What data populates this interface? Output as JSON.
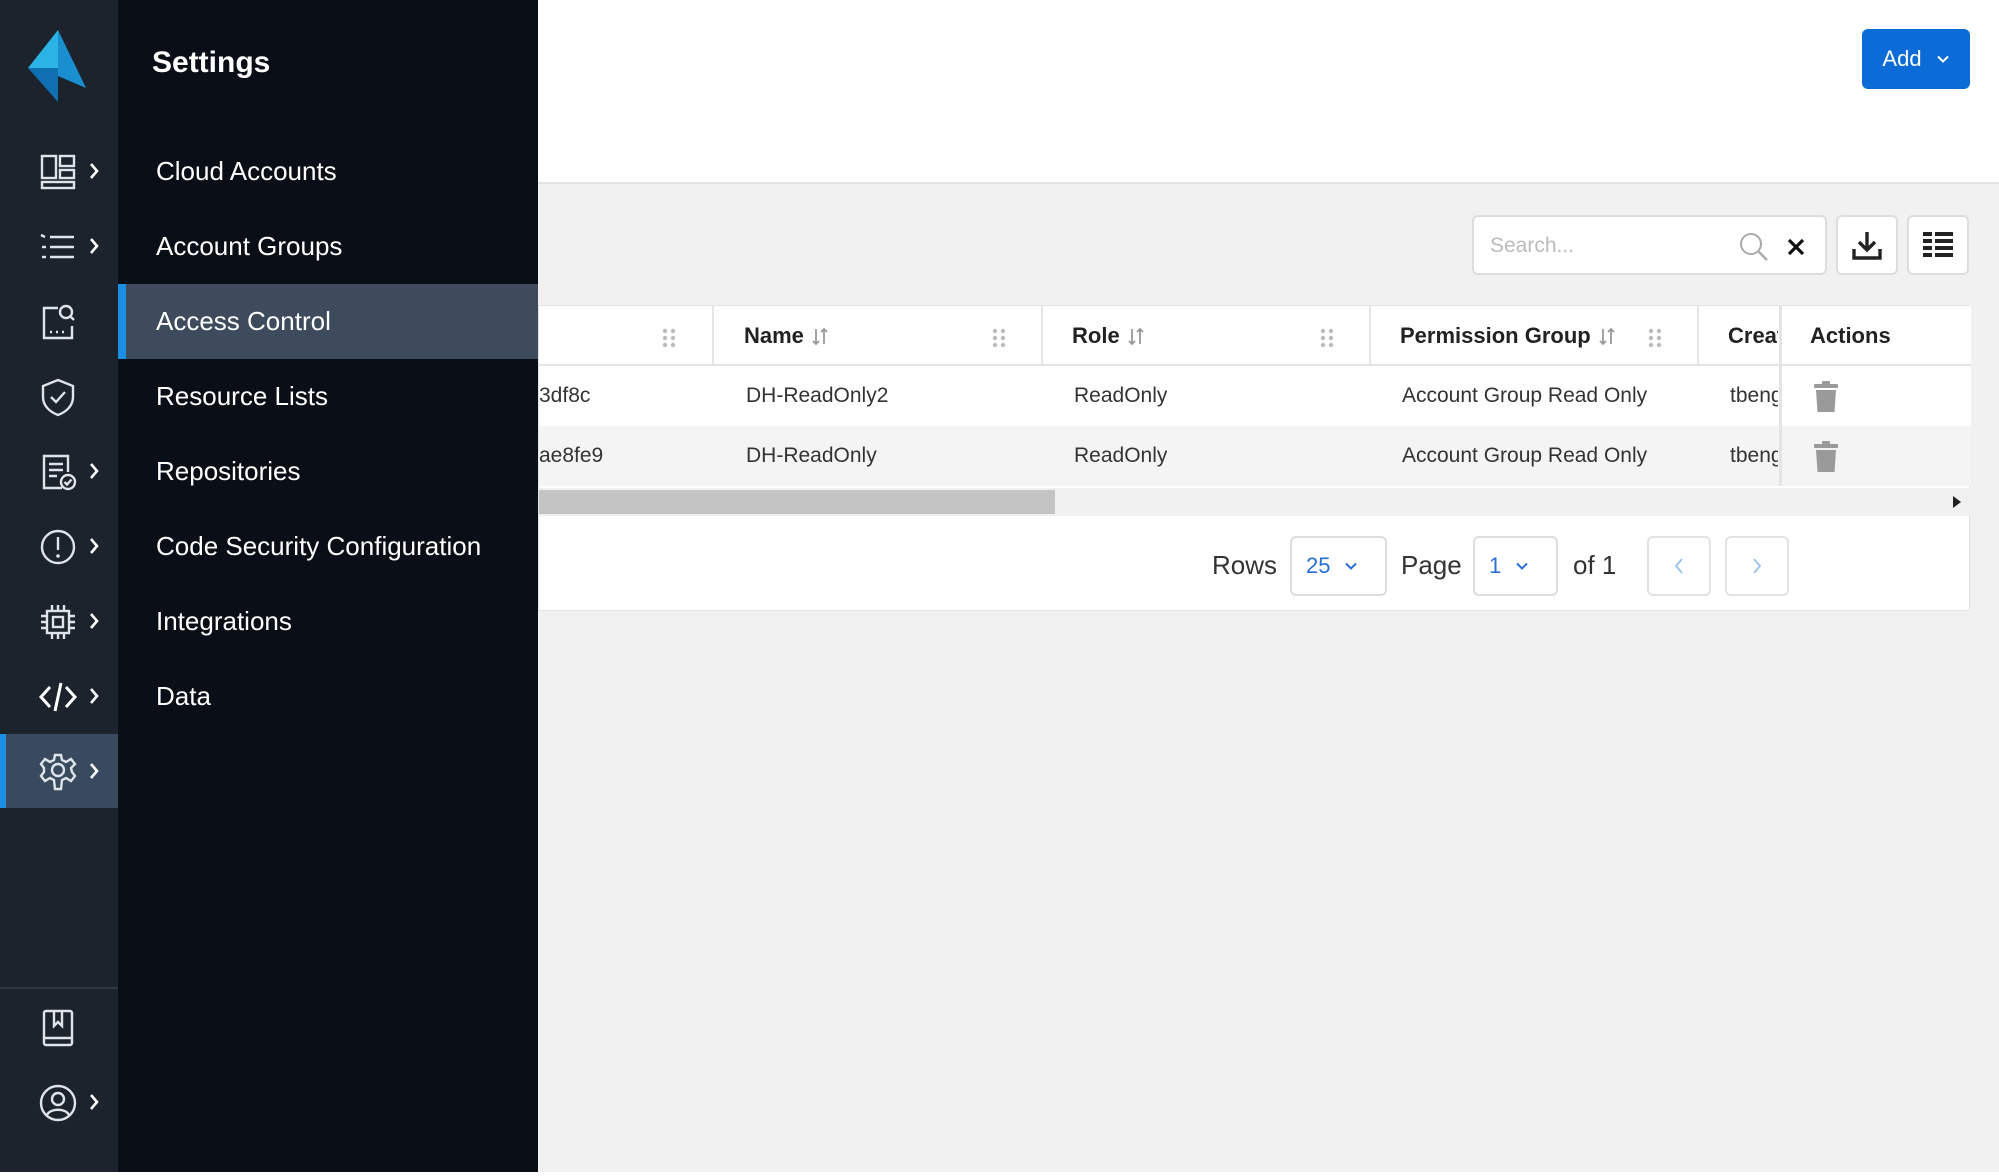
{
  "header": {
    "add_label": "Add"
  },
  "toolbar": {
    "search_placeholder": "Search..."
  },
  "table": {
    "columns": {
      "name": "Name",
      "role": "Role",
      "permission_group": "Permission Group",
      "created": "Creat",
      "actions": "Actions"
    },
    "rows": [
      {
        "id": "3df8c",
        "name": "DH-ReadOnly2",
        "role": "ReadOnly",
        "permission_group": "Account Group Read Only",
        "created_by": "tbeng"
      },
      {
        "id": "ae8fe9",
        "name": "DH-ReadOnly",
        "role": "ReadOnly",
        "permission_group": "Account Group Read Only",
        "created_by": "tbeng"
      }
    ]
  },
  "pagination": {
    "rows_label": "Rows",
    "rows_value": "25",
    "page_label": "Page",
    "page_value": "1",
    "of_label": "of 1"
  },
  "settings": {
    "title": "Settings",
    "items": [
      {
        "label": "Cloud Accounts"
      },
      {
        "label": "Account Groups"
      },
      {
        "label": "Access Control"
      },
      {
        "label": "Resource Lists"
      },
      {
        "label": "Repositories"
      },
      {
        "label": "Code Security Configuration"
      },
      {
        "label": "Integrations"
      },
      {
        "label": "Data"
      }
    ],
    "active_item": "Access Control"
  },
  "rail": {
    "icons": [
      "dashboard-icon",
      "inventory-icon",
      "investigate-icon",
      "shield-icon",
      "compliance-icon",
      "alert-icon",
      "compute-icon",
      "code-icon",
      "gear-icon",
      "book-icon",
      "user-icon",
      "more-icon"
    ],
    "active_icon": "gear-icon"
  },
  "colors": {
    "accent": "#0b6bd7",
    "rail_bg": "#1c232c",
    "panel_bg": "#0a0f17",
    "active_indicator": "#1a8fe3"
  }
}
